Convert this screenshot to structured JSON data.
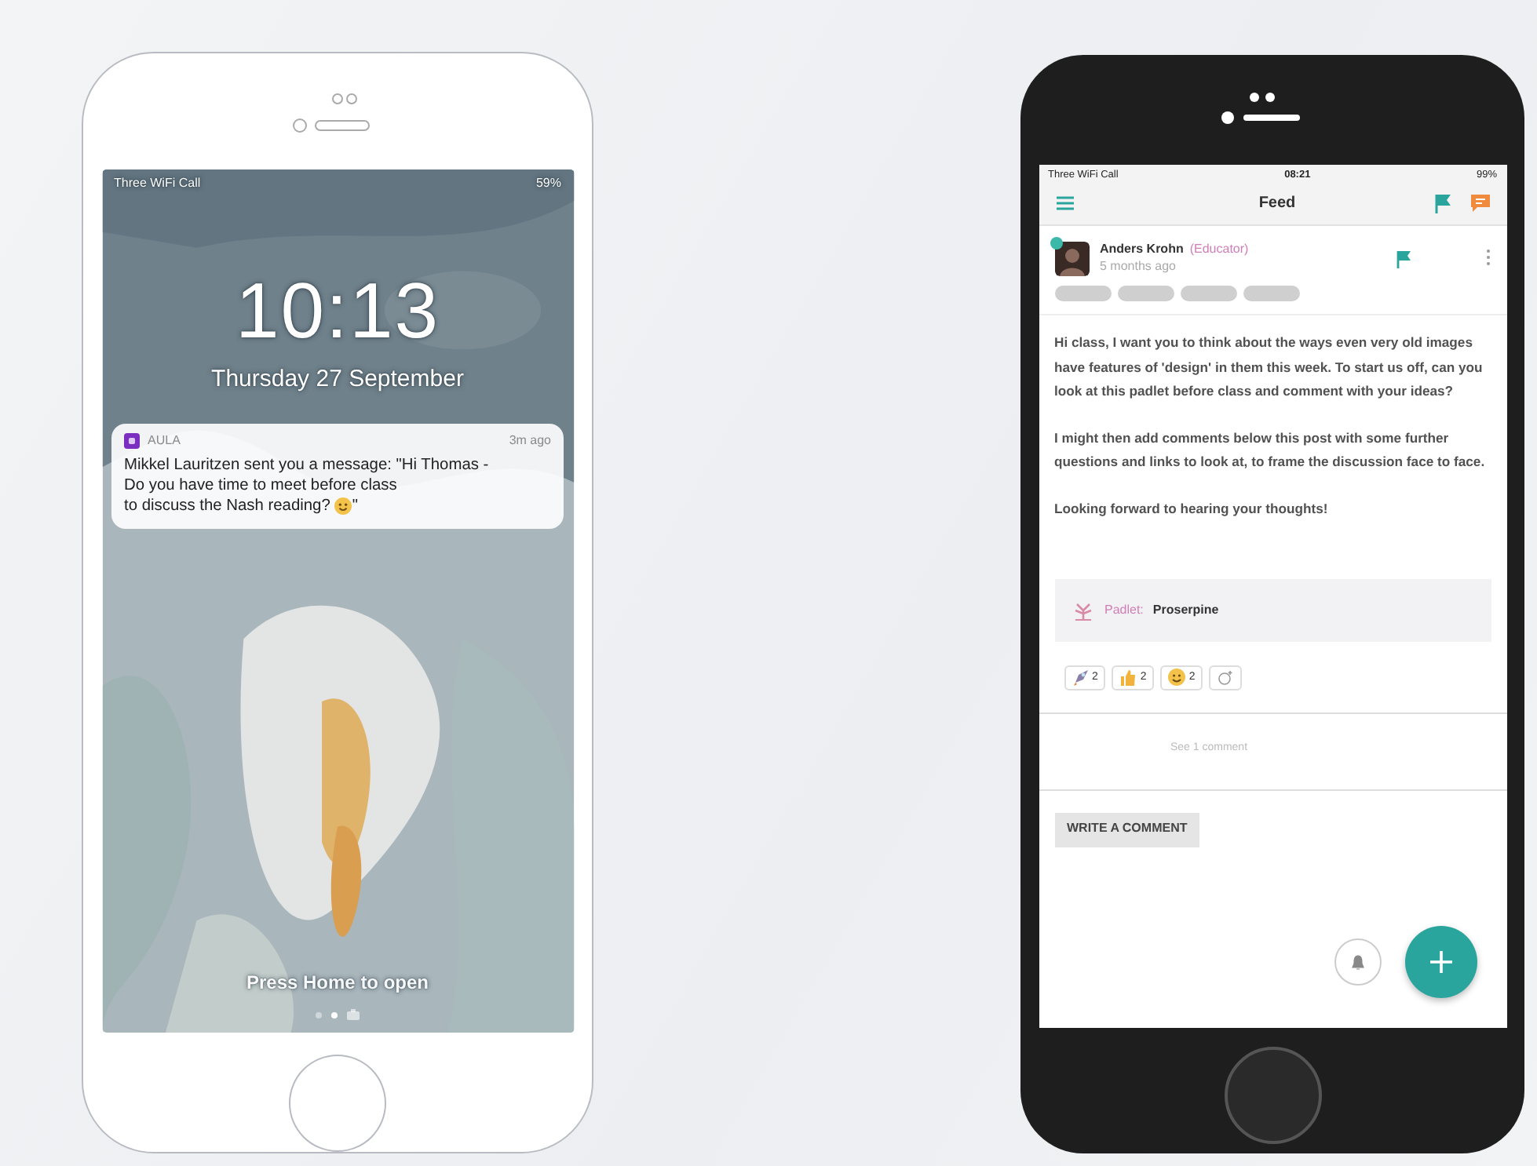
{
  "lock_screen": {
    "status_bar": {
      "carrier": "Three WiFi Call",
      "battery": "59%"
    },
    "time": "10:13",
    "date": "Thursday 27 September",
    "notification": {
      "app": "AULA",
      "age": "3m ago",
      "message": "Mikkel Lauritzen sent you a message: \"Hi Thomas - Do you have time to meet before class",
      "message_end": "to discuss the Nash reading?",
      "closing": "\""
    },
    "hint": "Press Home to open",
    "page_dots": [
      {
        "selected": false
      },
      {
        "selected": true
      }
    ]
  },
  "feed_app": {
    "status_bar": {
      "carrier": "Three WiFi Call",
      "time": "08:21",
      "battery": "99%"
    },
    "header": {
      "title": "Feed"
    },
    "post": {
      "author": "Anders Krohn",
      "role": "(Educator)",
      "age": "5 months ago",
      "online": true,
      "tags": [
        {
          "kind": "blurred"
        },
        {
          "kind": "blurred"
        },
        {
          "kind": "blurred"
        },
        {
          "kind": "blurred"
        }
      ],
      "paragraphs": [
        "Hi class, I want you to think about the ways even very old images have features of 'design' in them this week. To start us off, can you look at this padlet before class and comment with your ideas?",
        "I might then add comments below this post with some further questions and links to look at, to frame the discussion face to face.",
        "Looking forward to hearing your thoughts!"
      ],
      "attachment": {
        "label": "Padlet:",
        "title": "Proserpine"
      },
      "reactions": [
        {
          "kind": "rocket",
          "count": "2"
        },
        {
          "kind": "thumbs-up",
          "count": "2"
        },
        {
          "kind": "smile",
          "count": "2"
        },
        {
          "kind": "add"
        }
      ],
      "comments_link": "See 1 comment",
      "write_button": "WRITE A COMMENT"
    }
  }
}
